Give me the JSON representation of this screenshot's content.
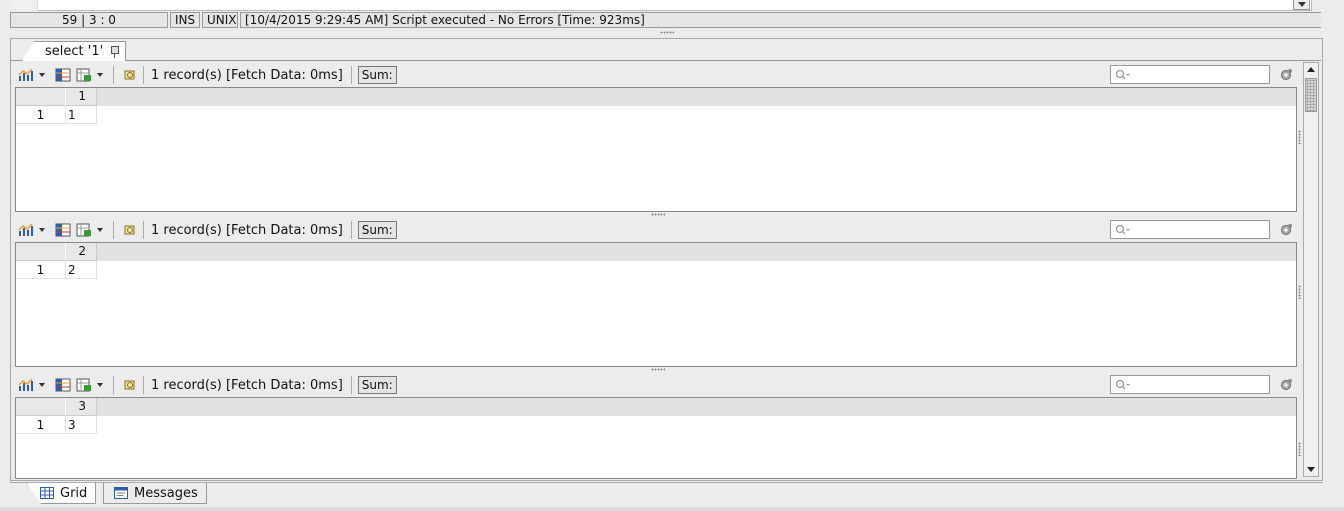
{
  "status_bar": {
    "position": "59 | 3 : 0",
    "mode": "INS",
    "line_ending": "UNIX",
    "message": "[10/4/2015 9:29:45 AM] Script executed - No Errors [Time: 923ms]"
  },
  "result_tab": {
    "label": "select '1'"
  },
  "grids": [
    {
      "toolbar": {
        "record_info": "1 record(s) [Fetch Data: 0ms]",
        "sum_label": "Sum:"
      },
      "columns": [
        "1"
      ],
      "rows": [
        {
          "row_number": "1",
          "cells": [
            "1"
          ]
        }
      ]
    },
    {
      "toolbar": {
        "record_info": "1 record(s) [Fetch Data: 0ms]",
        "sum_label": "Sum:"
      },
      "columns": [
        "2"
      ],
      "rows": [
        {
          "row_number": "1",
          "cells": [
            "2"
          ]
        }
      ]
    },
    {
      "toolbar": {
        "record_info": "1 record(s) [Fetch Data: 0ms]",
        "sum_label": "Sum:"
      },
      "columns": [
        "3"
      ],
      "rows": [
        {
          "row_number": "1",
          "cells": [
            "3"
          ]
        }
      ]
    }
  ],
  "bottom_tabs": [
    {
      "label": "Grid",
      "icon": "grid-icon",
      "active": true
    },
    {
      "label": "Messages",
      "icon": "messages-icon",
      "active": false
    }
  ],
  "colors": {
    "chart_orange": "#f0a030",
    "chart_blue": "#2a5fb0",
    "export_green": "#3a9a3a"
  }
}
